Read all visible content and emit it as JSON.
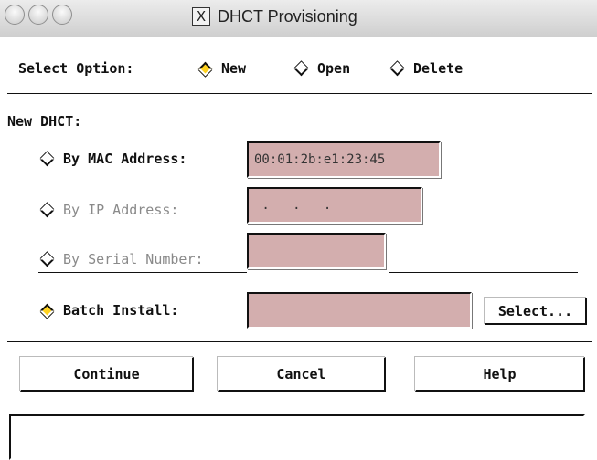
{
  "window": {
    "title": "DHCT Provisioning",
    "title_icon": "X"
  },
  "select_option": {
    "label": "Select Option:",
    "options": [
      {
        "label": "New",
        "selected": true
      },
      {
        "label": "Open",
        "selected": false
      },
      {
        "label": "Delete",
        "selected": false
      }
    ]
  },
  "new_dhct": {
    "heading": "New DHCT:",
    "by_mac": {
      "label": "By MAC Address:",
      "value": "00:01:2b:e1:23:45",
      "enabled": true,
      "selected": false
    },
    "by_ip": {
      "label": "By IP Address:",
      "value": " .   .   . ",
      "enabled": false,
      "selected": false
    },
    "by_serial": {
      "label": "By Serial Number:",
      "value": "",
      "enabled": false,
      "selected": false
    },
    "batch": {
      "label": "Batch Install:",
      "value": "",
      "selected": true,
      "select_button": "Select..."
    }
  },
  "buttons": {
    "continue": "Continue",
    "cancel": "Cancel",
    "help": "Help"
  },
  "status_text": "",
  "colors": {
    "field_bg": "#d3aeae",
    "selected_diamond": "#ffd21f"
  }
}
